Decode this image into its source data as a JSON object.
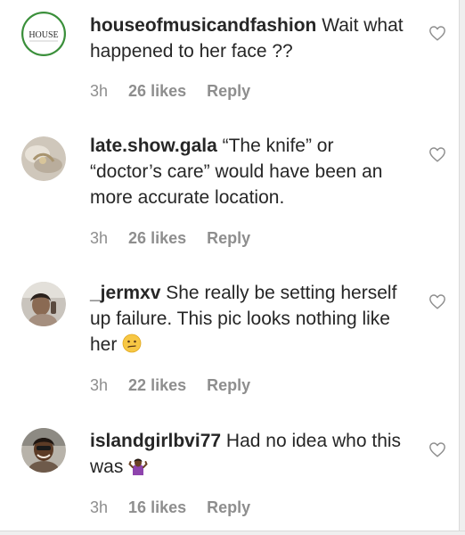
{
  "comments": [
    {
      "username": "houseofmusicandfashion",
      "text": "Wait what happened to her face ??",
      "time": "3h",
      "likes": "26 likes",
      "reply": "Reply",
      "avatar_label": "HOUSE"
    },
    {
      "username": "late.show.gala",
      "text": "“The knife” or “doctor’s care” would have been an more accurate location.",
      "time": "3h",
      "likes": "26 likes",
      "reply": "Reply"
    },
    {
      "username": "_jermxv",
      "text": "She really be setting herself up failure. This pic looks nothing like her",
      "emoji": "confused-face",
      "time": "3h",
      "likes": "22 likes",
      "reply": "Reply"
    },
    {
      "username": "islandgirlbvi77",
      "text": "Had no idea who this was",
      "emoji": "person-shrugging",
      "time": "3h",
      "likes": "16 likes",
      "reply": "Reply"
    }
  ],
  "colors": {
    "text": "#262626",
    "meta": "#8e8e8e",
    "avatar_ring": "#3a8f3a"
  },
  "icons": {
    "like": "heart-outline-icon"
  }
}
